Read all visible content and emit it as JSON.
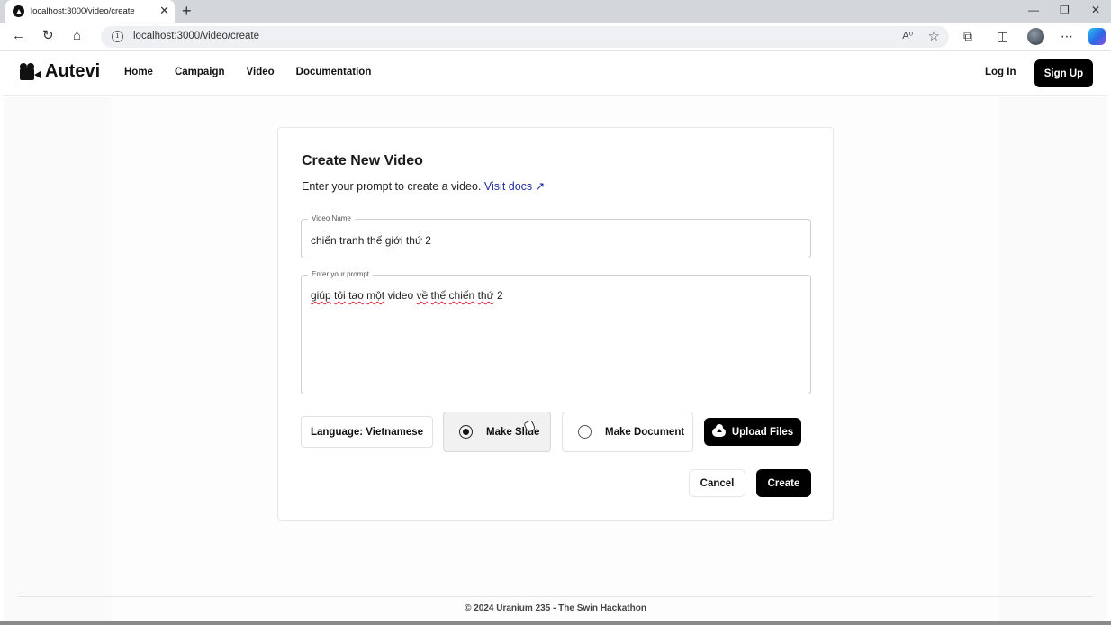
{
  "browser": {
    "tab_title": "localhost:3000/video/create",
    "url": "localhost:3000/video/create",
    "read_aloud_glyph": "A⁰"
  },
  "header": {
    "brand": "Autevi",
    "nav": [
      "Home",
      "Campaign",
      "Video",
      "Documentation"
    ],
    "login": "Log In",
    "signup": "Sign Up"
  },
  "form": {
    "title": "Create New Video",
    "subtitle": "Enter your prompt to create a video.",
    "docs_link": "Visit docs ↗",
    "video_name_label": "Video Name",
    "video_name_value": "chiến tranh thế giới thứ 2",
    "prompt_label": "Enter your prompt",
    "prompt_words": [
      "giúp",
      "tôi",
      "tao",
      "một",
      "video",
      "về",
      "thế",
      "chiến",
      "thứ",
      "2"
    ],
    "language_button": "Language: Vietnamese",
    "make_slide": "Make Slide",
    "make_document": "Make Document",
    "upload_files": "Upload Files",
    "cancel": "Cancel",
    "create": "Create",
    "selected_option": "make_slide"
  },
  "footer": {
    "text": "© 2024 Uranium 235 - The Swin Hackathon"
  }
}
